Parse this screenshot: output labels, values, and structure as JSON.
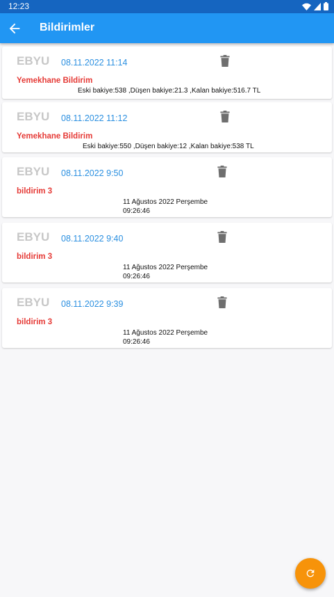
{
  "status_bar": {
    "time": "12:23"
  },
  "header": {
    "title": "Bildirimler"
  },
  "notifications": [
    {
      "source": "EBYU",
      "date": "08.11.2022 11:14",
      "subject": "Yemekhane Bildirim",
      "message_line1": "Eski bakiye:538 ,Düşen bakiye:21.3 ,Kalan bakiye:516.7 TL",
      "message_line2": ""
    },
    {
      "source": "EBYU",
      "date": "08.11.2022 11:12",
      "subject": "Yemekhane Bildirim",
      "message_line1": "Eski bakiye:550 ,Düşen bakiye:12 ,Kalan bakiye:538 TL",
      "message_line2": ""
    },
    {
      "source": "EBYU",
      "date": "08.11.2022 9:50",
      "subject": "bildirim 3",
      "message_line1": "11 Ağustos 2022 Perşembe",
      "message_line2": "09:26:46"
    },
    {
      "source": "EBYU",
      "date": "08.11.2022 9:40",
      "subject": "bildirim 3",
      "message_line1": "11 Ağustos 2022 Perşembe",
      "message_line2": "09:26:46"
    },
    {
      "source": "EBYU",
      "date": "08.11.2022 9:39",
      "subject": "bildirim 3",
      "message_line1": "11 Ağustos 2022 Perşembe",
      "message_line2": "09:26:46"
    }
  ],
  "icons": {
    "back": "arrow-left-icon",
    "delete": "trash-icon",
    "refresh": "refresh-icon",
    "wifi": "wifi-icon",
    "signal": "signal-icon",
    "battery": "battery-icon"
  },
  "colors": {
    "status_bar": "#1565c0",
    "app_bar": "#2196f3",
    "date": "#2a8fe0",
    "subject": "#e53935",
    "fab": "#f7930a"
  }
}
